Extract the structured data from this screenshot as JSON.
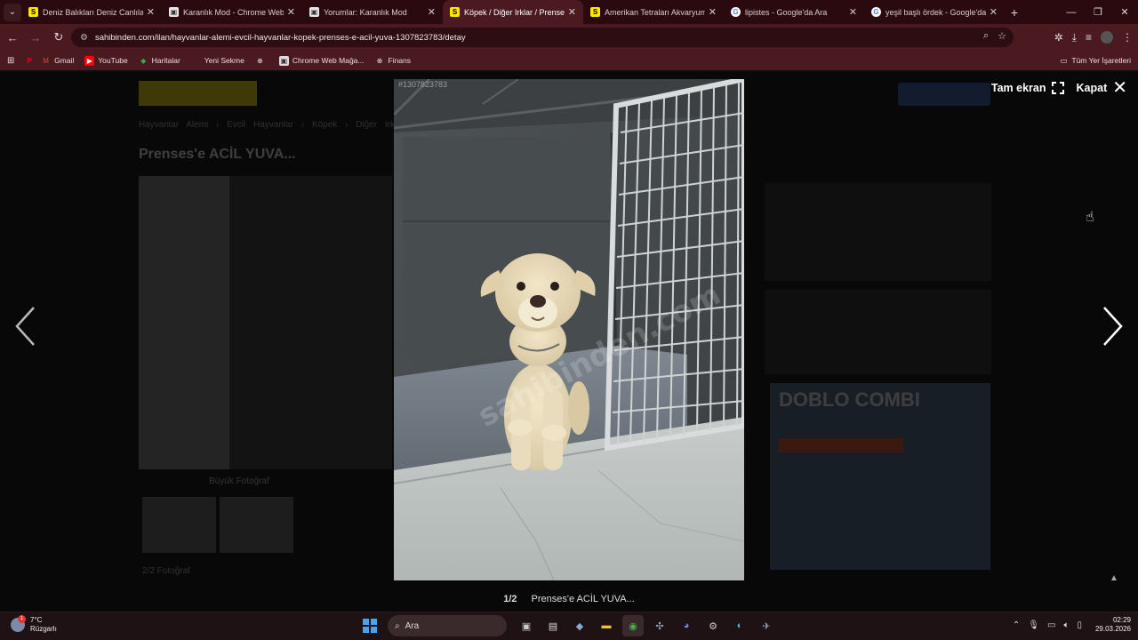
{
  "browser": {
    "tabs": [
      {
        "title": "Deniz Balıkları Deniz Canlıları Ç",
        "fav": "S",
        "kind": "s"
      },
      {
        "title": "Karanlık Mod - Chrome Web M",
        "fav": "▣",
        "kind": "d"
      },
      {
        "title": "Yorumlar: Karanlık Mod",
        "fav": "▣",
        "kind": "d"
      },
      {
        "title": "Köpek / Diğer Irklar / Prenses'e",
        "fav": "S",
        "kind": "s"
      },
      {
        "title": "Amerikan Tetraları Akvaryum B",
        "fav": "S",
        "kind": "s"
      },
      {
        "title": "lipistes - Google'da Ara",
        "fav": "G",
        "kind": "g"
      },
      {
        "title": "yeşil başlı ördek - Google'da Ar",
        "fav": "G",
        "kind": "g"
      }
    ],
    "url": "sahibinden.com/ilan/hayvanlar-alemi-evcil-hayvanlar-kopek-prenses-e-acil-yuva-1307823783/detay",
    "bookmarks": [
      "Gmail",
      "YouTube",
      "Haritalar",
      "Yeni Sekme",
      "Chrome Web Mağa...",
      "Finans"
    ],
    "all_bookmarks": "Tüm Yer İşaretleri"
  },
  "background": {
    "breadcrumb": "Hayvanlar Alemi › Evcil Hayvanlar › Köpek › Diğer Irkla",
    "title": "Prenses'e ACİL YUVA...",
    "big_photo": "Büyük Fotoğraf",
    "photo_count": "2/2 Fotoğraf",
    "ad_title": "DOBLO COMBI"
  },
  "viewer": {
    "listing_id": "#1307823783",
    "fullscreen_label": "Tam ekran",
    "close_label": "Kapat",
    "counter": "1/2",
    "caption": "Prenses'e ACİL YUVA...",
    "watermark": "sahibinden.com"
  },
  "taskbar": {
    "temperature": "7°C",
    "weather_desc": "Rüzgarlı",
    "weather_badge": "1",
    "search_placeholder": "Ara",
    "time": "02:29",
    "date": "29.03.2026"
  }
}
